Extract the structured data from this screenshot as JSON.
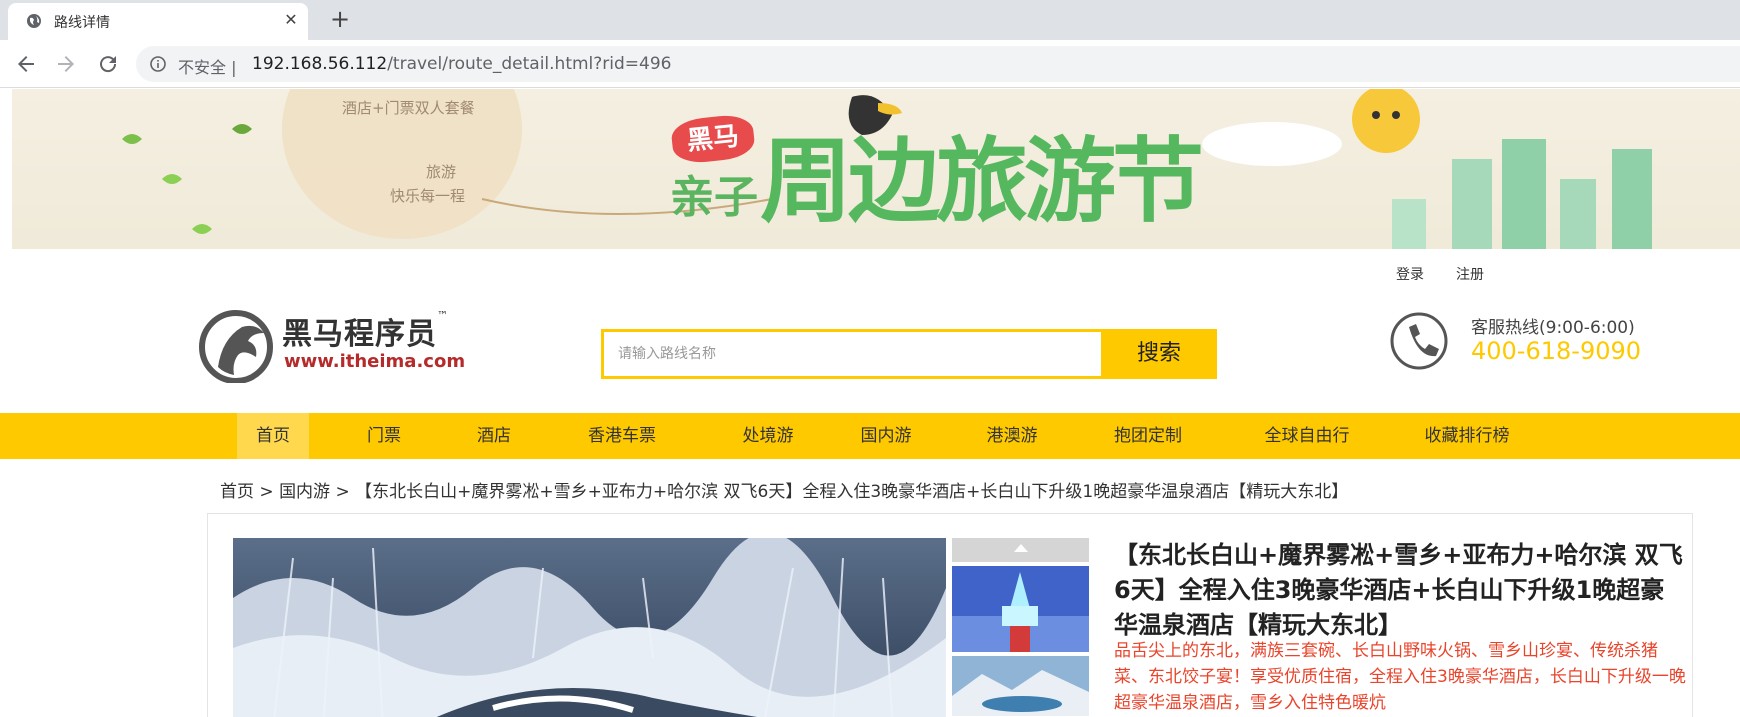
{
  "browser": {
    "tab_title": "路线详情",
    "tab_close": "✕",
    "new_tab": "+",
    "security_label": "不安全",
    "url_host": "192.168.56.112",
    "url_path": "/travel/route_detail.html?rid=496"
  },
  "banner": {
    "badge": "黑马",
    "subtitle": "亲子",
    "headline": "周边旅游节",
    "cloud_text_1": "酒店+门票双人套餐",
    "cloud_text_2": "旅游",
    "cloud_text_3": "快乐每一程"
  },
  "header": {
    "login": "登录",
    "register": "注册",
    "logo_name": "黑马程序员",
    "logo_tm": "™",
    "logo_url": "www.itheima.com",
    "search_placeholder": "请输入路线名称",
    "search_button": "搜索",
    "hotline_label": "客服热线(9:00-6:00)",
    "hotline_number": "400-618-9090"
  },
  "nav": {
    "items": [
      "首页",
      "门票",
      "酒店",
      "香港车票",
      "处境游",
      "国内游",
      "港澳游",
      "抱团定制",
      "全球自由行",
      "收藏排行榜"
    ],
    "active": "首页"
  },
  "breadcrumb": {
    "home": "首页",
    "separator": " > ",
    "category": "国内游",
    "current": "【东北长白山+魔界雾凇+雪乡+亚布力+哈尔滨 双飞6天】全程入住3晚豪华酒店+长白山下升级1晚超豪华温泉酒店【精玩大东北】"
  },
  "route": {
    "title": "【东北长白山+魔界雾凇+雪乡+亚布力+哈尔滨 双飞6天】全程入住3晚豪华酒店+长白山下升级1晚超豪华温泉酒店【精玩大东北】",
    "description": "品舌尖上的东北，满族三套碗、长白山野味火锅、雪乡山珍宴、传统杀猪菜、东北饺子宴！享受优质住宿，全程入住3晚豪华酒店，长白山下升级一晚超豪华温泉酒店，雪乡入住特色暖炕"
  },
  "colors": {
    "brand_yellow": "#ffc900",
    "description_red": "#e8452c",
    "banner_green": "#56b85e"
  }
}
